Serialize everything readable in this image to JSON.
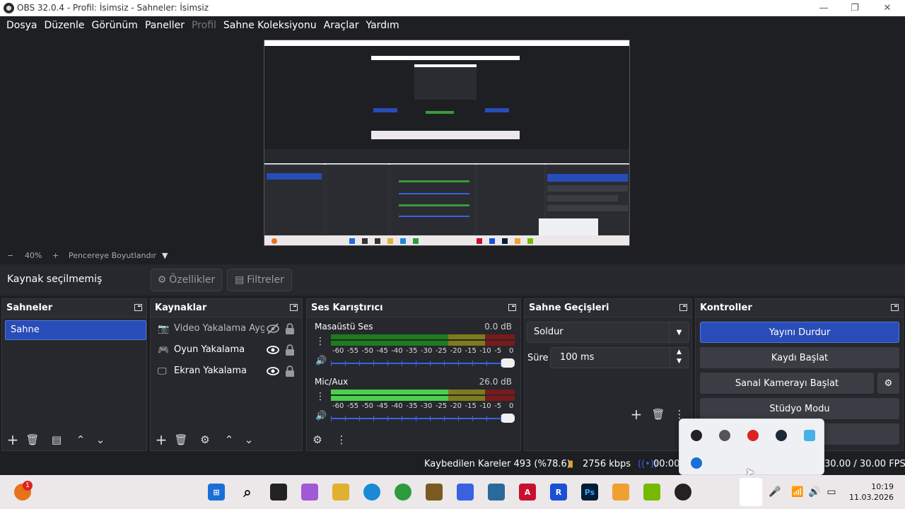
{
  "window": {
    "title": "OBS 32.0.4 - Profil: İsimsiz - Sahneler: İsimsiz"
  },
  "menu": [
    "Dosya",
    "Düzenle",
    "Görünüm",
    "Paneller",
    "Profil",
    "Sahne Koleksiyonu",
    "Araçlar",
    "Yardım"
  ],
  "zoom": {
    "minus": "−",
    "level": "40%",
    "plus": "+",
    "fit": "Pencereye Boyutlandır"
  },
  "source_toolbar": {
    "no_source": "Kaynak seçilmemiş",
    "properties": "Özellikler",
    "filters": "Filtreler"
  },
  "scenes": {
    "title": "Sahneler",
    "items": [
      "Sahne"
    ]
  },
  "sources": {
    "title": "Kaynaklar",
    "items": [
      "Video Yakalama Aygı",
      "Oyun Yakalama",
      "Ekran Yakalama"
    ]
  },
  "mixer": {
    "title": "Ses Karıştırıcı",
    "channels": [
      {
        "name": "Masaüstü Ses",
        "db": "0.0 dB",
        "level": 0
      },
      {
        "name": "Mic/Aux",
        "db": "26.0 dB",
        "level": 0.64
      }
    ],
    "ticks": [
      "-60",
      "-55",
      "-50",
      "-45",
      "-40",
      "-35",
      "-30",
      "-25",
      "-20",
      "-15",
      "-10",
      "-5",
      "0"
    ]
  },
  "transitions": {
    "title": "Sahne Geçişleri",
    "selected": "Soldur",
    "duration_label": "Süre",
    "duration": "100 ms"
  },
  "controls": {
    "title": "Kontroller",
    "stop_stream": "Yayını Durdur",
    "start_record": "Kaydı Başlat",
    "virtual_cam": "Sanal Kamerayı Başlat",
    "studio_mode": "Stüdyo Modu"
  },
  "status": {
    "dropped_frames": "Kaybedilen Kareler 493 (%78.6)",
    "bitrate": "2756 kbps",
    "stream_time": "00:00",
    "fps": "30.00 / 30.00 FPS"
  },
  "taskbar": {
    "time": "10:19",
    "date": "11.03.2026",
    "badge": "1"
  },
  "colors": {
    "accent": "#284cb8",
    "dock_bg": "#26282d",
    "app_bg": "#1e1f23"
  }
}
